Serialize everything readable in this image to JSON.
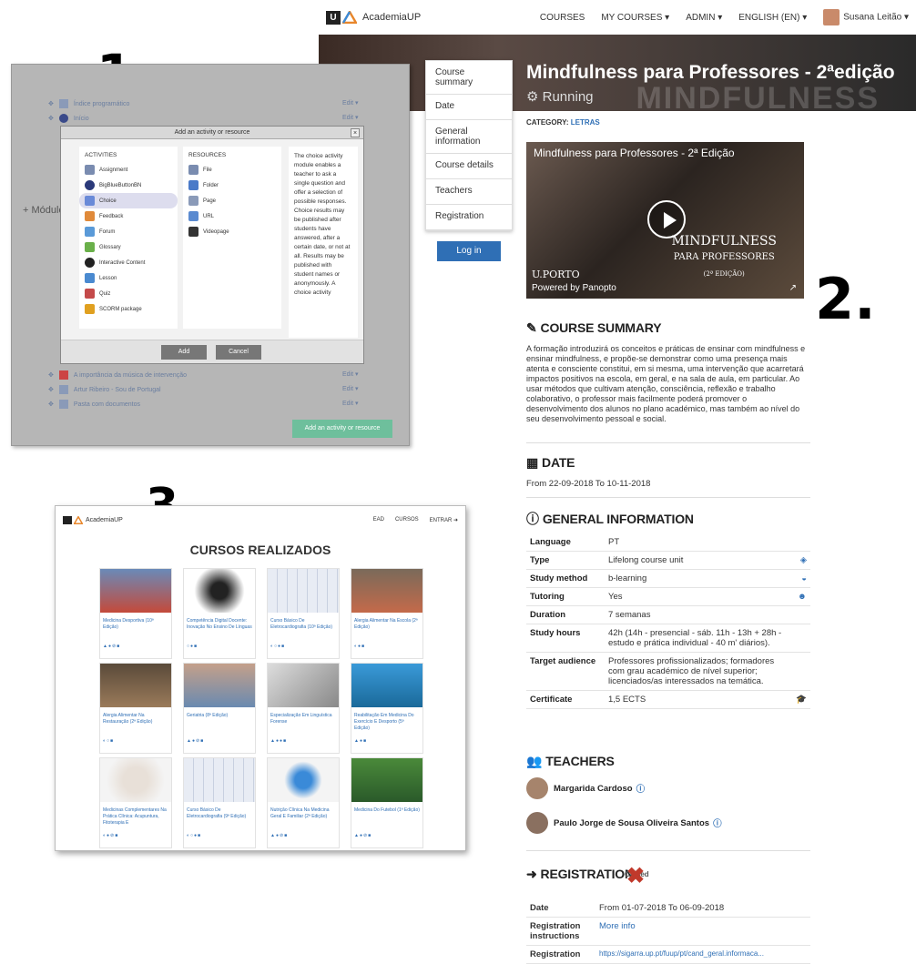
{
  "labels": {
    "one": "1.",
    "two": "2.",
    "three": "3."
  },
  "topnav": {
    "brand": "AcademiaUP",
    "items": [
      "COURSES",
      "MY COURSES ▾",
      "ADMIN ▾",
      "ENGLISH (EN) ▾"
    ],
    "user": "Susana Leitão ▾"
  },
  "banner": {
    "ghost": "MINDFULNESS",
    "title": "Mindfulness para Professores - 2ªedição",
    "status": "Running"
  },
  "coursenav": {
    "items": [
      "Course summary",
      "Date",
      "General information",
      "Course details",
      "Teachers",
      "Registration"
    ],
    "login": "Log in"
  },
  "category": {
    "label": "CATEGORY:",
    "value": "LETRAS"
  },
  "video": {
    "title": "Mindfulness para Professores - 2ª Edição",
    "overlay1": "MINDFULNESS",
    "overlay2": "PARA PROFESSORES",
    "overlay3": "(2ª EDIÇÃO)",
    "brand": "U.PORTO",
    "powered": "Powered by Panopto"
  },
  "sections": {
    "summary": "COURSE SUMMARY",
    "date": "DATE",
    "general": "GENERAL INFORMATION",
    "teachers": "TEACHERS",
    "registration": "REGISTRATION"
  },
  "summary": "A formação introduzirá os conceitos e práticas de ensinar com mindfulness e ensinar mindfulness, e propõe-se demonstrar como uma presença mais atenta e consciente constitui, em si mesma, uma intervenção que acarretará impactos positivos na escola, em geral, e na sala de aula, em particular. Ao usar métodos que cultivam atenção, consciência, reflexão e trabalho colaborativo, o professor mais facilmente poderá promover o desenvolvimento dos alunos no plano académico, mas também ao nível do seu desenvolvimento pessoal e social.",
  "date": "From 22-09-2018 To 10-11-2018",
  "info": [
    {
      "k": "Language",
      "v": "PT"
    },
    {
      "k": "Type",
      "v": "Lifelong course unit"
    },
    {
      "k": "Study method",
      "v": "b-learning"
    },
    {
      "k": "Tutoring",
      "v": "Yes"
    },
    {
      "k": "Duration",
      "v": "7 semanas"
    },
    {
      "k": "Study hours",
      "v": "42h (14h - presencial - sáb. 11h - 13h + 28h - estudo e prática individual - 40 m' diários)."
    },
    {
      "k": "Target audience",
      "v": "Professores profissionalizados; formadores com grau académico de nível superior; licenciados/as interessados na temática."
    },
    {
      "k": "Certificate",
      "v": "1,5 ECTS"
    }
  ],
  "teachers": [
    "Margarida Cardoso",
    "Paulo Jorge de Sousa Oliveira Santos"
  ],
  "reg_badge": "Closed",
  "registration": [
    {
      "k": "Date",
      "v": "From 01-07-2018 To 06-09-2018"
    },
    {
      "k": "Registration instructions",
      "v": "More info"
    },
    {
      "k": "Registration",
      "v": "https://sigarra.up.pt/fuup/pt/cand_geral.informaca..."
    }
  ],
  "panel1": {
    "rows": [
      "Índice programático",
      "Início"
    ],
    "rows_bottom": [
      "A importância da música de intervenção",
      "Artur Ribeiro - Sou de Portugal",
      "Pasta com documentos"
    ],
    "edit": "Edit ▾",
    "section": "Módulo",
    "modal_title": "Add an activity or resource",
    "activities_h": "ACTIVITIES",
    "resources_h": "RESOURCES",
    "activities": [
      "Assignment",
      "BigBlueButtonBN",
      "Choice",
      "Feedback",
      "Forum",
      "Glossary",
      "Interactive Content",
      "Lesson",
      "Quiz",
      "SCORM package"
    ],
    "resources": [
      "File",
      "Folder",
      "Page",
      "URL",
      "Videopage"
    ],
    "desc": "The choice activity module enables a teacher to ask a single question and offer a selection of possible responses. Choice results may be published after students have answered, after a certain date, or not at all. Results may be published with student names or anonymously. A choice activity",
    "add": "Add",
    "cancel": "Cancel",
    "addres": "Add an activity or resource"
  },
  "panel3": {
    "brand": "AcademiaUP",
    "nav": [
      "EAD",
      "CURSOS",
      "ENTRAR ➜"
    ],
    "title": "CURSOS REALIZADOS",
    "cards": [
      "Medicina Desportiva (10ª Edição)",
      "Competência Digital Docente: Inovação No Ensino De Línguas",
      "Curso Básico De Eletrocardiografia (10ª Edição)",
      "Alergia Alimentar Na Escola (2ª Edição)",
      "Alergia Alimentar Na Restauração (2ª Edição)",
      "Geriatria (8ª Edição)",
      "Especialização Em Linguística Forense",
      "Reabilitação Em Medicina Do Exercício E Desporto (5ª Edição)",
      "Medicinas Complementares Na Prática Clínica: Acupuntura, Fitoterapia E",
      "Curso Básico De Eletrocardiografia (9ª Edição)",
      "Nutrição Clínica Na Medicina Geral E Familiar (2ª Edição)",
      "Medicina Do Futebol (1ª Edição)"
    ]
  }
}
